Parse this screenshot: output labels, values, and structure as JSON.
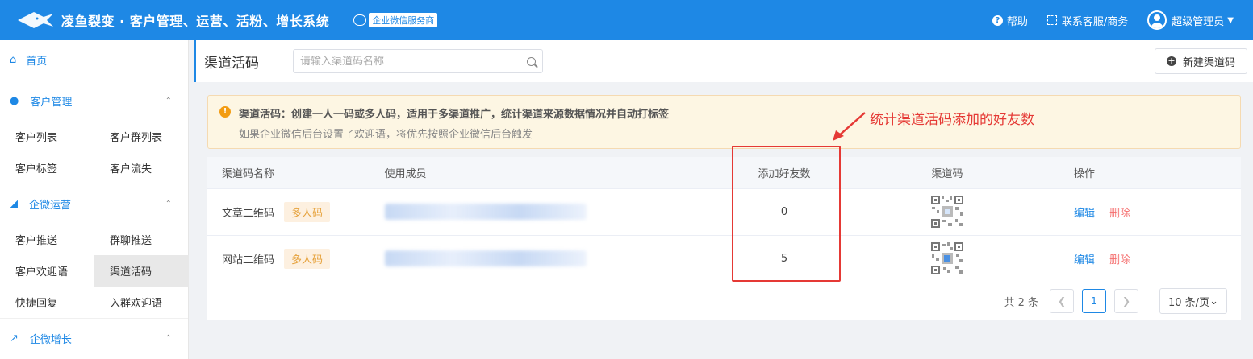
{
  "header": {
    "app_title": "凌鱼裂变 · 客户管理、运营、活粉、增长系统",
    "wecom_badge": "企业微信服务商",
    "help": "帮助",
    "contact": "联系客服/商务",
    "user": "超级管理员"
  },
  "sidebar": {
    "home": "首页",
    "groups": [
      {
        "label": "客户管理",
        "items": [
          "客户列表",
          "客户群列表",
          "客户标签",
          "客户流失"
        ]
      },
      {
        "label": "企微运营",
        "items": [
          "客户推送",
          "群聊推送",
          "客户欢迎语",
          "渠道活码",
          "快捷回复",
          "入群欢迎语"
        ],
        "active": "渠道活码"
      },
      {
        "label": "企微增长",
        "items": []
      }
    ]
  },
  "page": {
    "title": "渠道活码",
    "search_placeholder": "请输入渠道码名称",
    "new_button": "新建渠道码"
  },
  "notice": {
    "title": "渠道活码：创建一人一码或多人码，适用于多渠道推广，统计渠道来源数据情况并自动打标签",
    "desc": "如果企业微信后台设置了欢迎语，将优先按照企业微信后台触发"
  },
  "annotation": {
    "text": "统计渠道活码添加的好友数",
    "color": "#e53935"
  },
  "table": {
    "columns": [
      "渠道码名称",
      "使用成员",
      "添加好友数",
      "渠道码",
      "操作"
    ],
    "rows": [
      {
        "name": "文章二维码",
        "tag": "多人码",
        "friends": "0",
        "edit": "编辑",
        "delete": "删除"
      },
      {
        "name": "网站二维码",
        "tag": "多人码",
        "friends": "5",
        "edit": "编辑",
        "delete": "删除"
      }
    ]
  },
  "pagination": {
    "total": "共 2 条",
    "current": "1",
    "page_size": "10 条/页"
  },
  "colors": {
    "primary": "#1e88e5",
    "danger": "#f56c6c",
    "warning": "#e6a23c"
  }
}
